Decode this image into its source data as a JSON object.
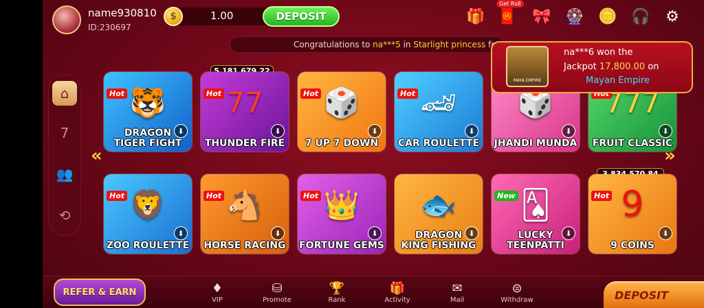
{
  "user": {
    "name": "name930810",
    "id": "ID:230697"
  },
  "balance": {
    "value": "1.00",
    "deposit_label": "DEPOSIT"
  },
  "header_badge": "Get Rs8",
  "header_icons": [
    "gift-cart-icon",
    "redeem-envelope-icon",
    "gift-box-icon",
    "lucky-wheel-icon",
    "bonus-icon",
    "support-icon",
    "settings-gear-icon"
  ],
  "marquee": {
    "prefix": "Congratulations to ",
    "user": "na***5",
    "middle": " in ",
    "game": "Starlight princess",
    "suffix": " for win"
  },
  "jackpot_popup": {
    "thumb_label": "MAYA EMPIRE",
    "line1": "na***6 won the",
    "line2_prefix": "Jackpot ",
    "amount": "17,800.00",
    "line2_suffix": " on",
    "game": "Mayan Empire"
  },
  "games": [
    {
      "name": "DRAGON\nTIGER FIGHT",
      "badge": "Hot",
      "counter": ""
    },
    {
      "name": "THUNDER FIRE",
      "badge": "Hot",
      "counter": "5,181,679.22"
    },
    {
      "name": "7 UP 7 DOWN",
      "badge": "Hot",
      "counter": ""
    },
    {
      "name": "CAR ROULETTE",
      "badge": "Hot",
      "counter": ""
    },
    {
      "name": "JHANDI MUNDA",
      "badge": "",
      "counter": ""
    },
    {
      "name": "FRUIT CLASSIC",
      "badge": "Hot",
      "counter": ""
    },
    {
      "name": "ZOO ROULETTE",
      "badge": "Hot",
      "counter": ""
    },
    {
      "name": "HORSE RACING",
      "badge": "Hot",
      "counter": ""
    },
    {
      "name": "FORTUNE GEMS",
      "badge": "Hot",
      "counter": ""
    },
    {
      "name": "DRAGON\nKING FISHING",
      "badge": "",
      "counter": ""
    },
    {
      "name": "LUCKY\nTEENPATTI",
      "badge": "New",
      "counter": ""
    },
    {
      "name": "9 COINS",
      "badge": "Hot",
      "counter": "3,834,570.84"
    }
  ],
  "bottom_nav": {
    "refer": "REFER & EARN",
    "items": [
      "VIP",
      "Promote",
      "Rank",
      "Activity",
      "Mail",
      "Withdraw"
    ],
    "deposit": "DEPOSIT"
  }
}
